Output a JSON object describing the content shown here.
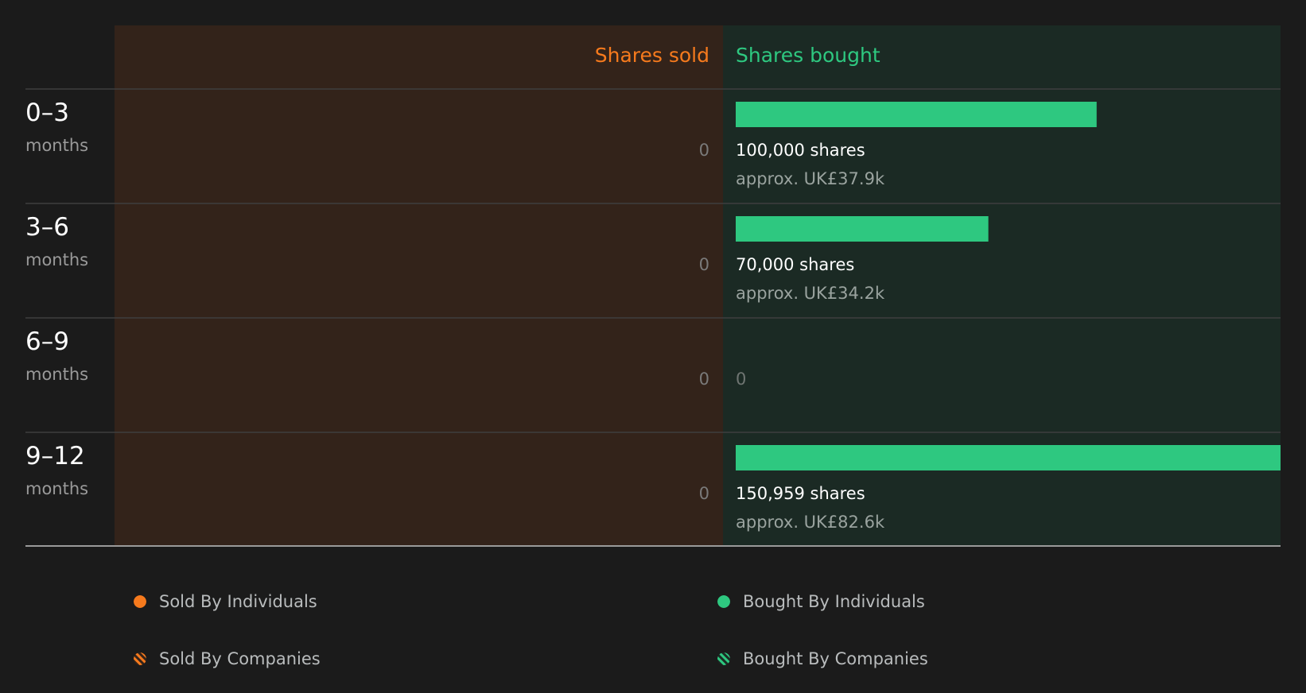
{
  "chart_data": {
    "type": "bar",
    "headers": {
      "sold": "Shares sold",
      "bought": "Shares bought"
    },
    "categories": [
      {
        "range": "0–3",
        "unit": "months"
      },
      {
        "range": "3–6",
        "unit": "months"
      },
      {
        "range": "6–9",
        "unit": "months"
      },
      {
        "range": "9–12",
        "unit": "months"
      }
    ],
    "series": [
      {
        "name": "Shares sold",
        "values": [
          0,
          0,
          0,
          0
        ],
        "labels": [
          "0",
          "0",
          "0",
          "0"
        ]
      },
      {
        "name": "Shares bought",
        "values": [
          100000,
          70000,
          0,
          150959
        ],
        "labels": [
          "100,000 shares",
          "70,000 shares",
          "0",
          "150,959 shares"
        ],
        "approx": [
          "approx. UK£37.9k",
          "approx. UK£34.2k",
          "",
          "approx. UK£82.6k"
        ]
      }
    ],
    "xlim": [
      0,
      150959
    ],
    "legend": [
      {
        "label": "Sold By Individuals",
        "style": "solid",
        "color": "#f67a1d"
      },
      {
        "label": "Bought By Individuals",
        "style": "solid",
        "color": "#2ec880"
      },
      {
        "label": "Sold By Companies",
        "style": "hatched",
        "color": "#f67a1d"
      },
      {
        "label": "Bought By Companies",
        "style": "hatched",
        "color": "#2ec880"
      }
    ],
    "legend_position": "bottom"
  },
  "colors": {
    "sold": "#f67a1d",
    "bought": "#2ec880",
    "sold_bg": "#33231a",
    "bought_bg": "#1b2a24",
    "page_bg": "#1b1b1b"
  }
}
